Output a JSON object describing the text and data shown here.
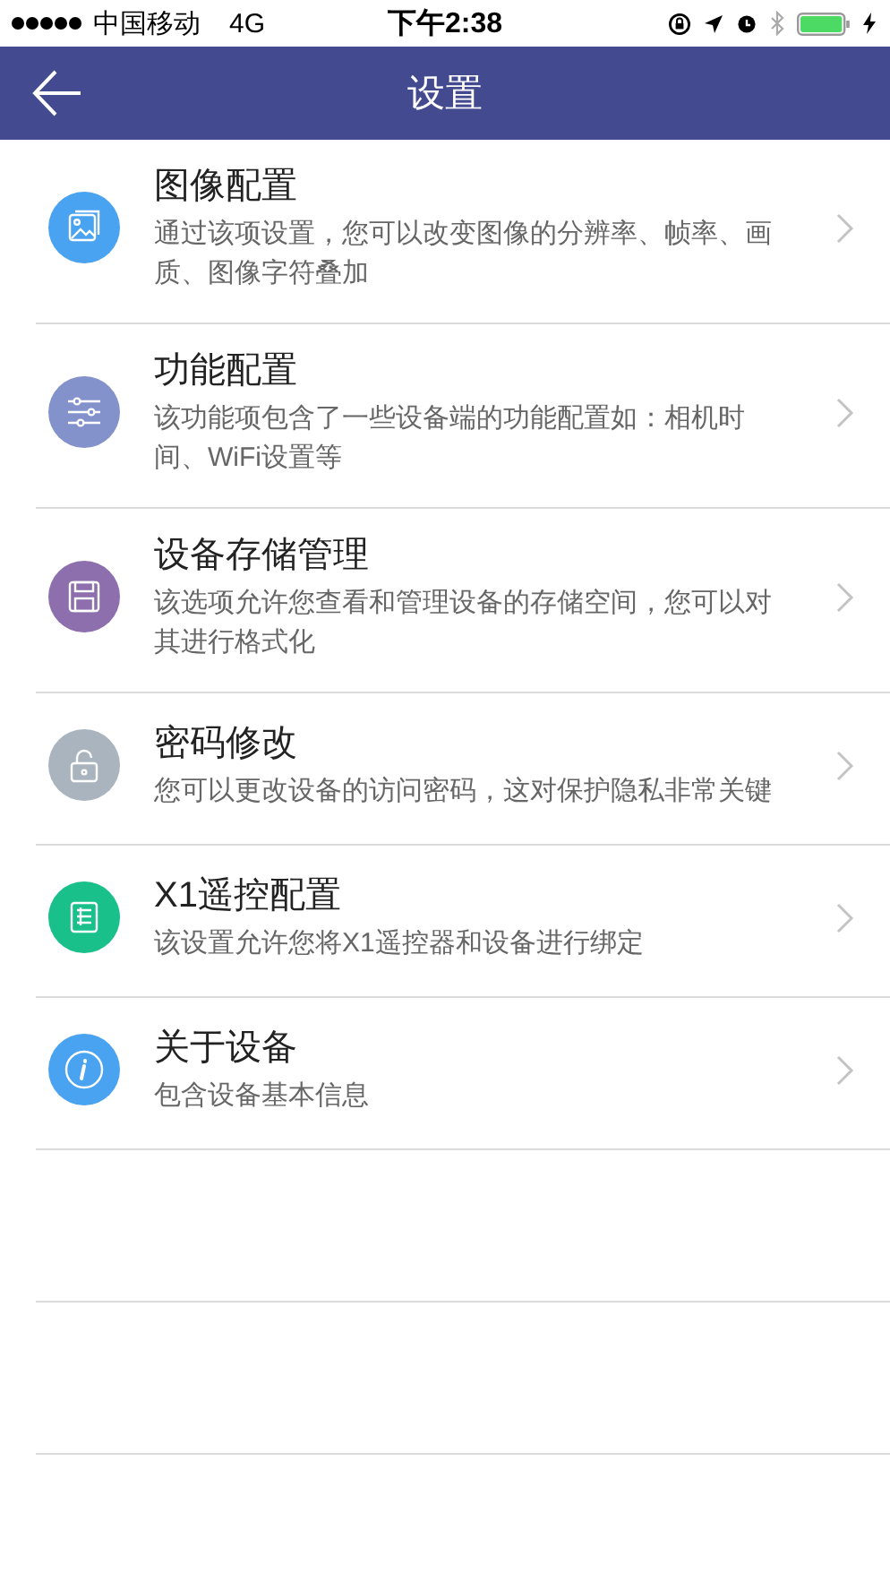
{
  "status_bar": {
    "carrier": "中国移动",
    "network": "4G",
    "time": "下午2:38"
  },
  "nav": {
    "title": "设置"
  },
  "items": [
    {
      "kind": "image",
      "color": "#4aa3f0",
      "title": "图像配置",
      "description": "通过该项设置，您可以改变图像的分辨率、帧率、画质、图像字符叠加"
    },
    {
      "kind": "sliders",
      "color": "#8492cc",
      "title": "功能配置",
      "description": "该功能项包含了一些设备端的功能配置如：相机时间、WiFi设置等"
    },
    {
      "kind": "storage",
      "color": "#8d6fae",
      "title": "设备存储管理",
      "description": "该选项允许您查看和管理设备的存储空间，您可以对其进行格式化"
    },
    {
      "kind": "lock",
      "color": "#aab4bf",
      "title": "密码修改",
      "description": "您可以更改设备的访问密码，这对保护隐私非常关键"
    },
    {
      "kind": "list",
      "color": "#19c08a",
      "title": "X1遥控配置",
      "description": "该设置允许您将X1遥控器和设备进行绑定"
    },
    {
      "kind": "info",
      "color": "#4aa3f0",
      "title": "关于设备",
      "description": "包含设备基本信息"
    }
  ]
}
